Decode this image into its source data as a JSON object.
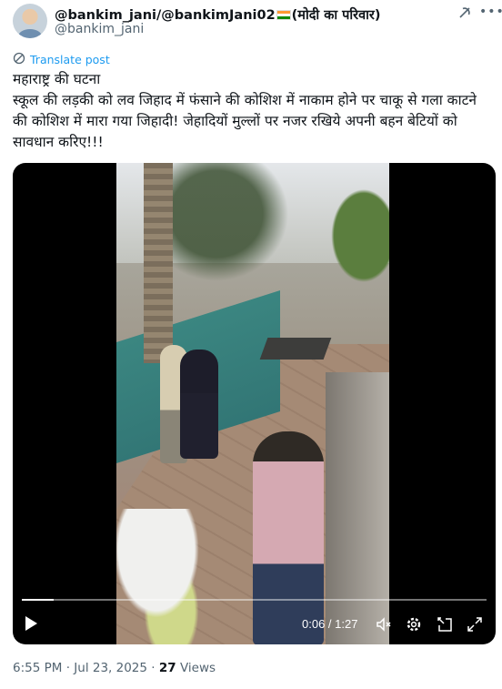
{
  "author": {
    "display_name_pre": "@bankim_jani/@bankimJani02",
    "display_name_post": "(मोदी का परिवार)",
    "handle": "@bankim_jani"
  },
  "icons": {
    "grok": "grok-icon",
    "more": "more-icon",
    "translate": "globe-icon",
    "play": "play-icon",
    "mute": "volume-mute-icon",
    "settings": "settings-gear-icon",
    "pip": "picture-in-picture-icon",
    "fullscreen": "fullscreen-icon"
  },
  "translate_label": "Translate post",
  "post_text": "महाराष्ट्र की घटना\nस्कूल की लड़की को लव जिहाद में फंसाने की कोशिश में नाकाम होने पर चाकू से गला काटने की कोशिश में मारा गया जिहादी! जेहादियों मुल्लों पर नजर रखिये अपनी बहन बेटियों को सावधान करिए!!!",
  "video": {
    "current_time": "0:06",
    "separator": " / ",
    "duration": "1:27",
    "progress_fraction": 0.069
  },
  "footer": {
    "time": "6:55 PM",
    "sep1": " · ",
    "date": "Jul 23, 2025",
    "sep2": " · ",
    "views_count": "27",
    "views_label": " Views"
  },
  "colors": {
    "link": "#1d9bf0",
    "secondary_text": "#536471",
    "primary_text": "#0f1419",
    "video_bg": "#000000"
  }
}
